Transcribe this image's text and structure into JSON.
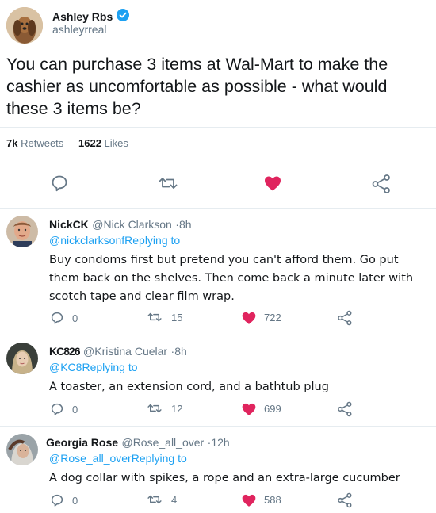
{
  "tweet": {
    "author_name": "Ashley Rbs",
    "author_handle": "ashleyrreal",
    "text": "You can purchase 3 items at Wal-Mart to make the cashier as uncomfortable as possible - what would these 3 items be?",
    "retweets_count": "7k",
    "retweets_label": "Retweets",
    "likes_count": "1622",
    "likes_label": "Likes"
  },
  "replies": [
    {
      "name": "NickCK",
      "handle": "@Nick Clarkson",
      "time": "8h",
      "replying_handle": "@nickclarksonf",
      "replying_text": "Replying to",
      "text": "Buy condoms first but pretend you can't afford them. Go put them back on the shelves. Then come back a minute later with scotch tape and clear film wrap.",
      "replies": "0",
      "retweets": "15",
      "likes": "722"
    },
    {
      "name": "KC826",
      "handle": "@Kristina Cuelar",
      "time": "8h",
      "replying_handle": "@KC8",
      "replying_text": "Replying to",
      "text": "A toaster, an extension cord, and a bathtub plug",
      "replies": "0",
      "retweets": "12",
      "likes": "699"
    },
    {
      "name": "Georgia Rose",
      "handle": "@Rose_all_over",
      "time": "12h",
      "replying_handle": "@Rose_all_over",
      "replying_text": "Replying to",
      "text": "A dog collar with spikes, a rope and an extra-large cucumber",
      "replies": "0",
      "retweets": "4",
      "likes": "588"
    }
  ],
  "colors": {
    "like": "#e0245e",
    "link": "#1da1f2",
    "muted": "#657786",
    "verified": "#1da1f2"
  },
  "icons": [
    "verified-badge-icon",
    "reply-icon",
    "retweet-icon",
    "heart-icon",
    "share-icon"
  ]
}
